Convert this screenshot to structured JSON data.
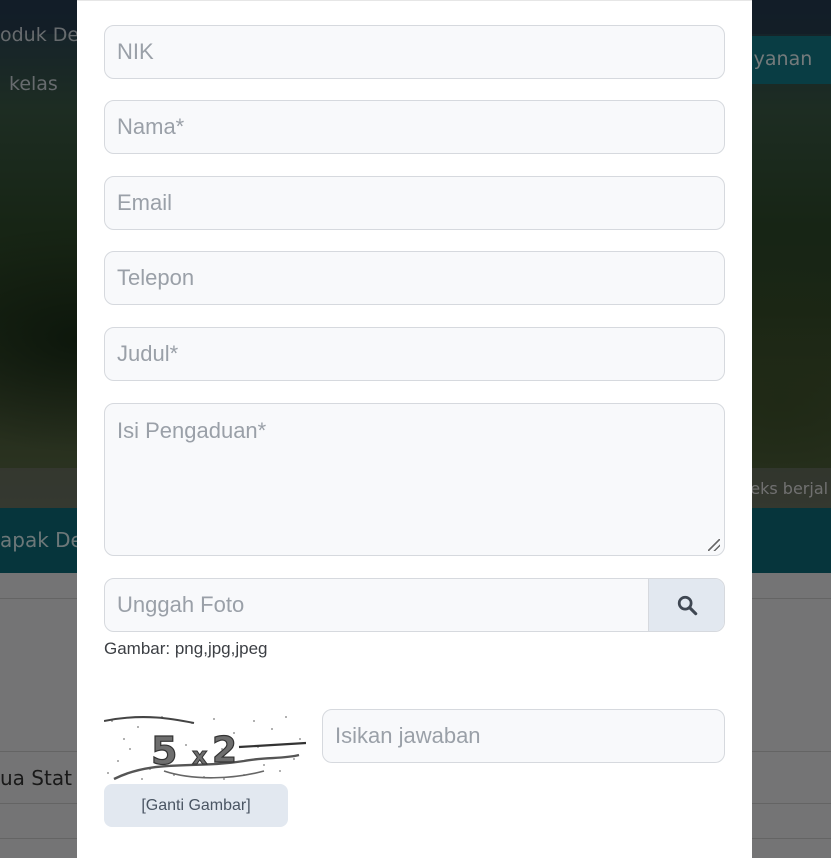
{
  "background": {
    "top_left_link": "oduk Des",
    "top_left_link2": "kelas",
    "top_right_button": "ayanan",
    "strip_text": "teks berjal",
    "teal_text": "apak De",
    "lower_text": "ua Stat"
  },
  "form": {
    "nik_placeholder": "NIK",
    "nama_placeholder": "Nama*",
    "email_placeholder": "Email",
    "telepon_placeholder": "Telepon",
    "judul_placeholder": "Judul*",
    "isi_placeholder": "Isi Pengaduan*",
    "upload_placeholder": "Unggah Foto",
    "upload_hint": "Gambar: png,jpg,jpeg",
    "captcha_placeholder": "Isikan jawaban",
    "ganti_label": "[Ganti Gambar]",
    "captcha_text": "5x2"
  },
  "icons": {
    "upload_button_icon": "search-icon"
  },
  "colors": {
    "field_bg": "#f8f9fb",
    "field_border": "#d6d9de",
    "button_bg": "#e2e8f0",
    "placeholder": "#9aa0a8",
    "teal": "#0d6b78"
  }
}
